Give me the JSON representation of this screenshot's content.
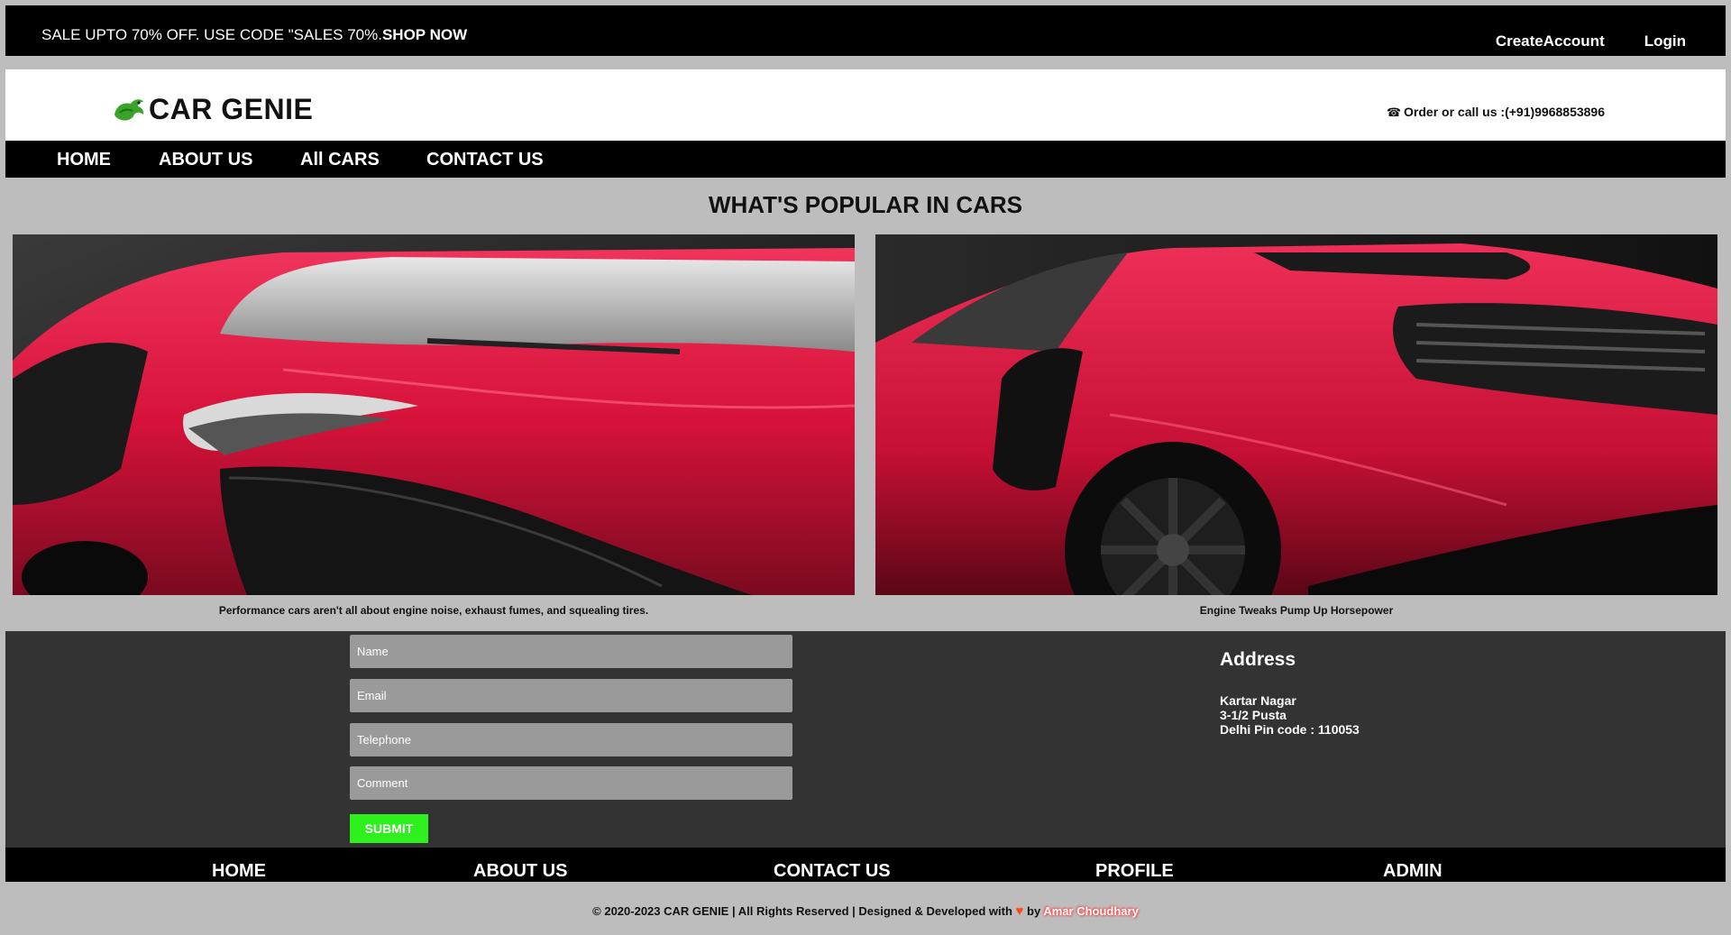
{
  "promo": {
    "text": "SALE UPTO 70% OFF. USE CODE \"SALES 70%.",
    "cta": "SHOP NOW",
    "create_account": "CreateAccount",
    "login": "Login"
  },
  "brand": {
    "name": "CAR GENIE",
    "contact_text": "Order or call us :(+91)9968853896",
    "logo_icon": "dragon-logo-icon",
    "phone_icon": "phone-icon"
  },
  "nav": {
    "items": [
      "HOME",
      "ABOUT US",
      "All CARS",
      "CONTACT US"
    ]
  },
  "main": {
    "heading": "WHAT'S POPULAR IN CARS",
    "cards": [
      {
        "caption": "Performance cars aren't all about engine noise, exhaust fumes, and squealing tires."
      },
      {
        "caption": "Engine Tweaks Pump Up Horsepower"
      }
    ]
  },
  "form": {
    "name_placeholder": "Name",
    "email_placeholder": "Email",
    "telephone_placeholder": "Telephone",
    "comment_placeholder": "Comment",
    "submit_label": "SUBMIT"
  },
  "address": {
    "title": "Address",
    "lines": [
      "Kartar Nagar",
      "3-1/2 Pusta",
      "Delhi Pin code : 110053"
    ]
  },
  "footer": {
    "nav": [
      "HOME",
      "ABOUT US",
      "CONTACT US",
      "PROFILE",
      "ADMIN"
    ],
    "copyright": "© 2020-2023 CAR GENIE | All Rights Reserved | Designed & Developed with",
    "by": "by",
    "author": "Amar Choudhary",
    "heart_icon": "heart-icon"
  },
  "colors": {
    "accent_green": "#2ef01d",
    "car_red": "#d6123a",
    "bar_black": "#000000",
    "form_band": "#333333"
  }
}
